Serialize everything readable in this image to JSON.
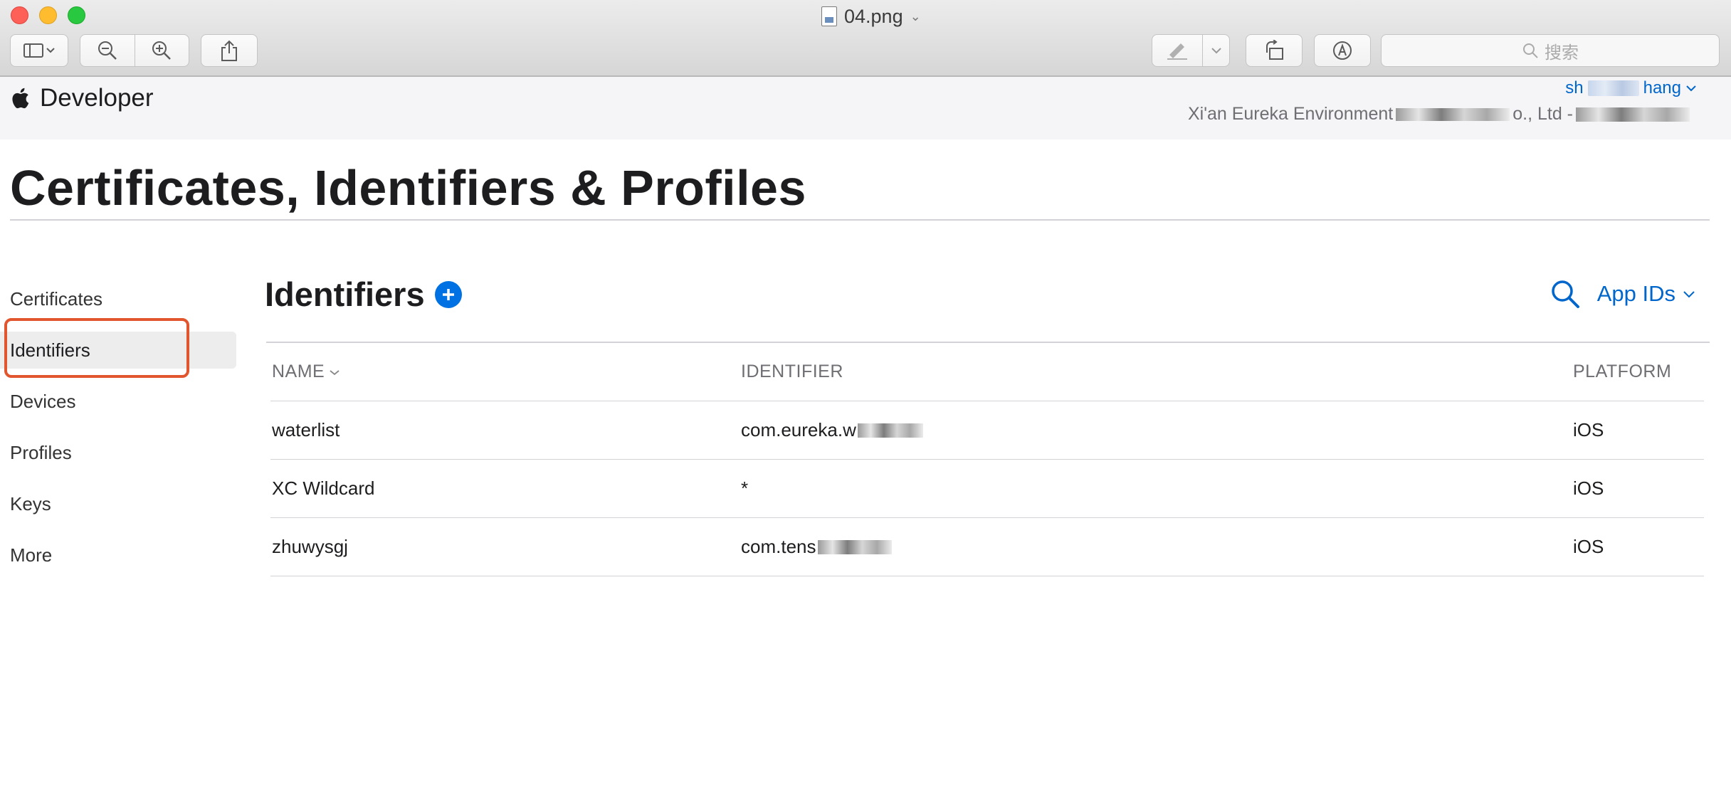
{
  "window": {
    "title": "04.png",
    "search_placeholder": "搜索",
    "toolbar": [
      "sidebar-toggle-icon",
      "zoom-out-icon",
      "zoom-in-icon",
      "share-icon",
      "markup-pen-icon",
      "rotate-icon",
      "annotate-icon"
    ]
  },
  "site": {
    "brand": "Developer",
    "user_name_start": "sh",
    "user_name_end": "hang",
    "team_name_start": "Xi'an Eureka Environment",
    "team_name_mid": "o., Ltd -"
  },
  "page": {
    "title": "Certificates, Identifiers & Profiles"
  },
  "sidebar": {
    "items": [
      {
        "label": "Certificates"
      },
      {
        "label": "Identifiers"
      },
      {
        "label": "Devices"
      },
      {
        "label": "Profiles"
      },
      {
        "label": "Keys"
      },
      {
        "label": "More"
      }
    ],
    "active": "Identifiers"
  },
  "main": {
    "section_title": "Identifiers",
    "filter_label": "App IDs",
    "table": {
      "headers": [
        "NAME",
        "IDENTIFIER",
        "PLATFORM"
      ],
      "rows": [
        {
          "name": "waterlist",
          "identifier": "com.eureka.w",
          "platform": "iOS"
        },
        {
          "name": "XC Wildcard",
          "identifier": "*",
          "platform": "iOS"
        },
        {
          "name": "zhuwysgj",
          "identifier": "com.tens",
          "platform": "iOS"
        }
      ]
    }
  },
  "colors": {
    "accent": "#0071e3",
    "link": "#0066cc",
    "highlight": "#e2562f"
  }
}
